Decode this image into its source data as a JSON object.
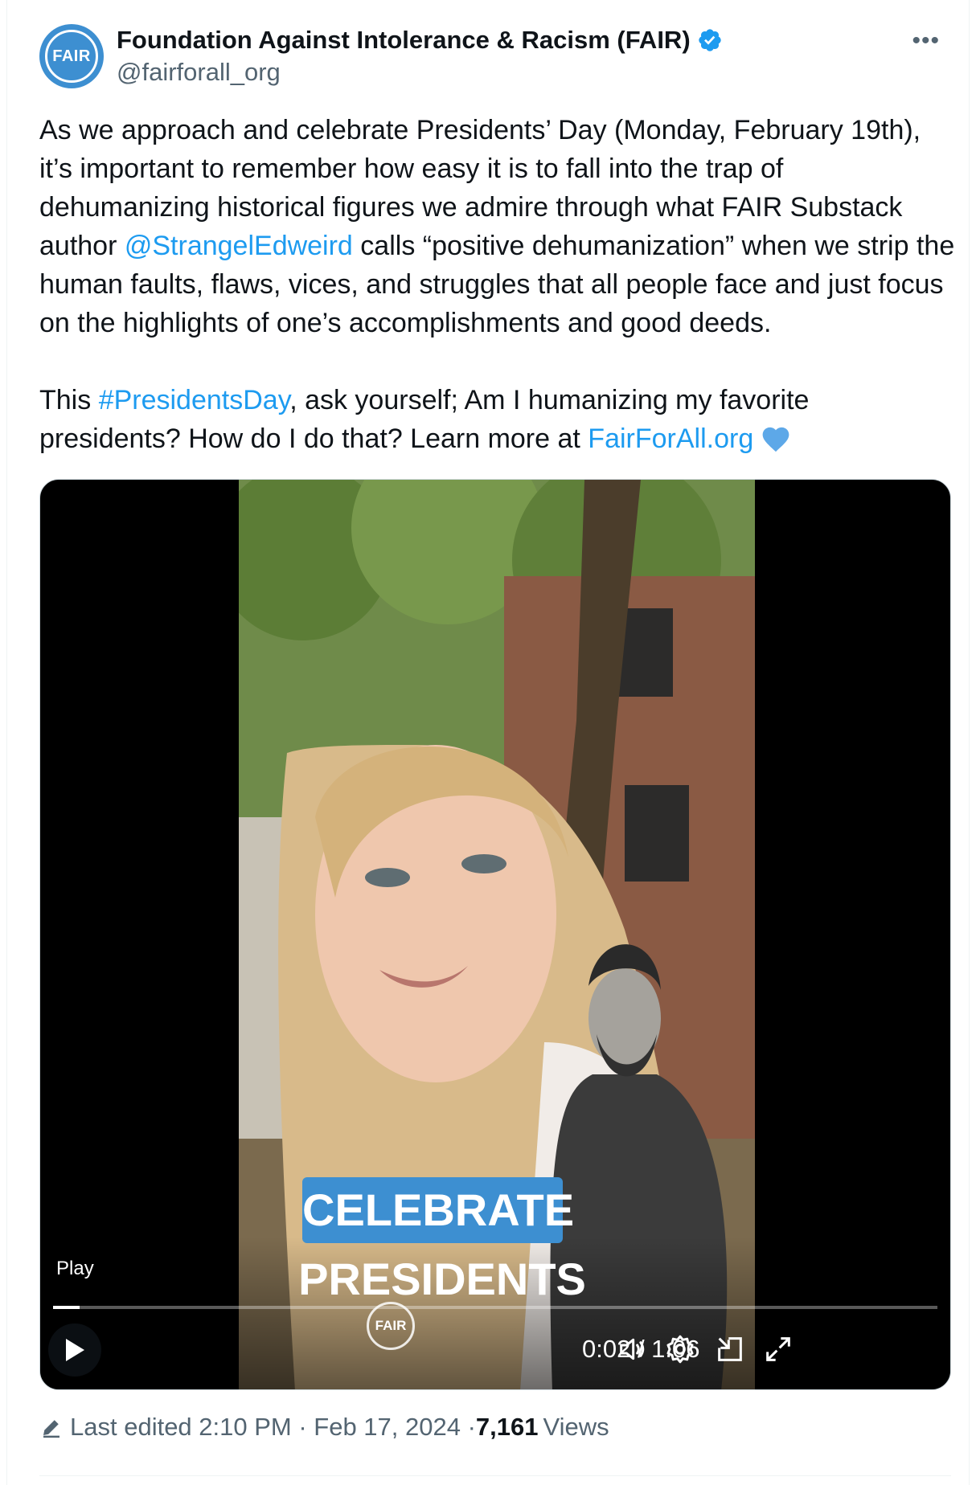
{
  "author": {
    "name": "Foundation Against Intolerance & Racism (FAIR)",
    "handle": "@fairforall_org",
    "avatar_text": "FAIR",
    "verified": true
  },
  "tweet": {
    "p1_a": "As we approach and celebrate Presidents’ Day (Monday, February 19th), it’s important to remember how easy it is to fall into the trap of dehumanizing historical figures we admire through what FAIR Substack author ",
    "mention": "@StrangelEdweird",
    "p1_b": " calls “positive dehumanization” when we strip the human faults, flaws, vices, and struggles that all people face and just focus on the highlights of one’s accomplishments and good deeds.",
    "p2_a": "This ",
    "hashtag": "#PresidentsDay",
    "p2_b": ", ask yourself; Am I humanizing my favorite presidents? How do I do that? Learn more at ",
    "link": "FairForAll.org"
  },
  "video": {
    "overlay_label": "CELEBRATE",
    "overlay_sub": "PRESIDENTS",
    "watermark": "FAIR",
    "play_label": "Play",
    "time": "0:02 / 1:06",
    "progress": 0.03
  },
  "footer": {
    "edited": "Last edited 2:10 PM · Feb 17, 2024 · ",
    "views_count": "7,161",
    "views_label": "Views"
  },
  "colors": {
    "accent": "#1d9bf0",
    "brand": "#3d8fd1",
    "muted": "#536471"
  },
  "icons": [
    "verified-badge-icon",
    "more-icon",
    "heart-icon",
    "play-icon",
    "volume-icon",
    "settings-icon",
    "pip-icon",
    "fullscreen-icon",
    "edit-icon"
  ]
}
